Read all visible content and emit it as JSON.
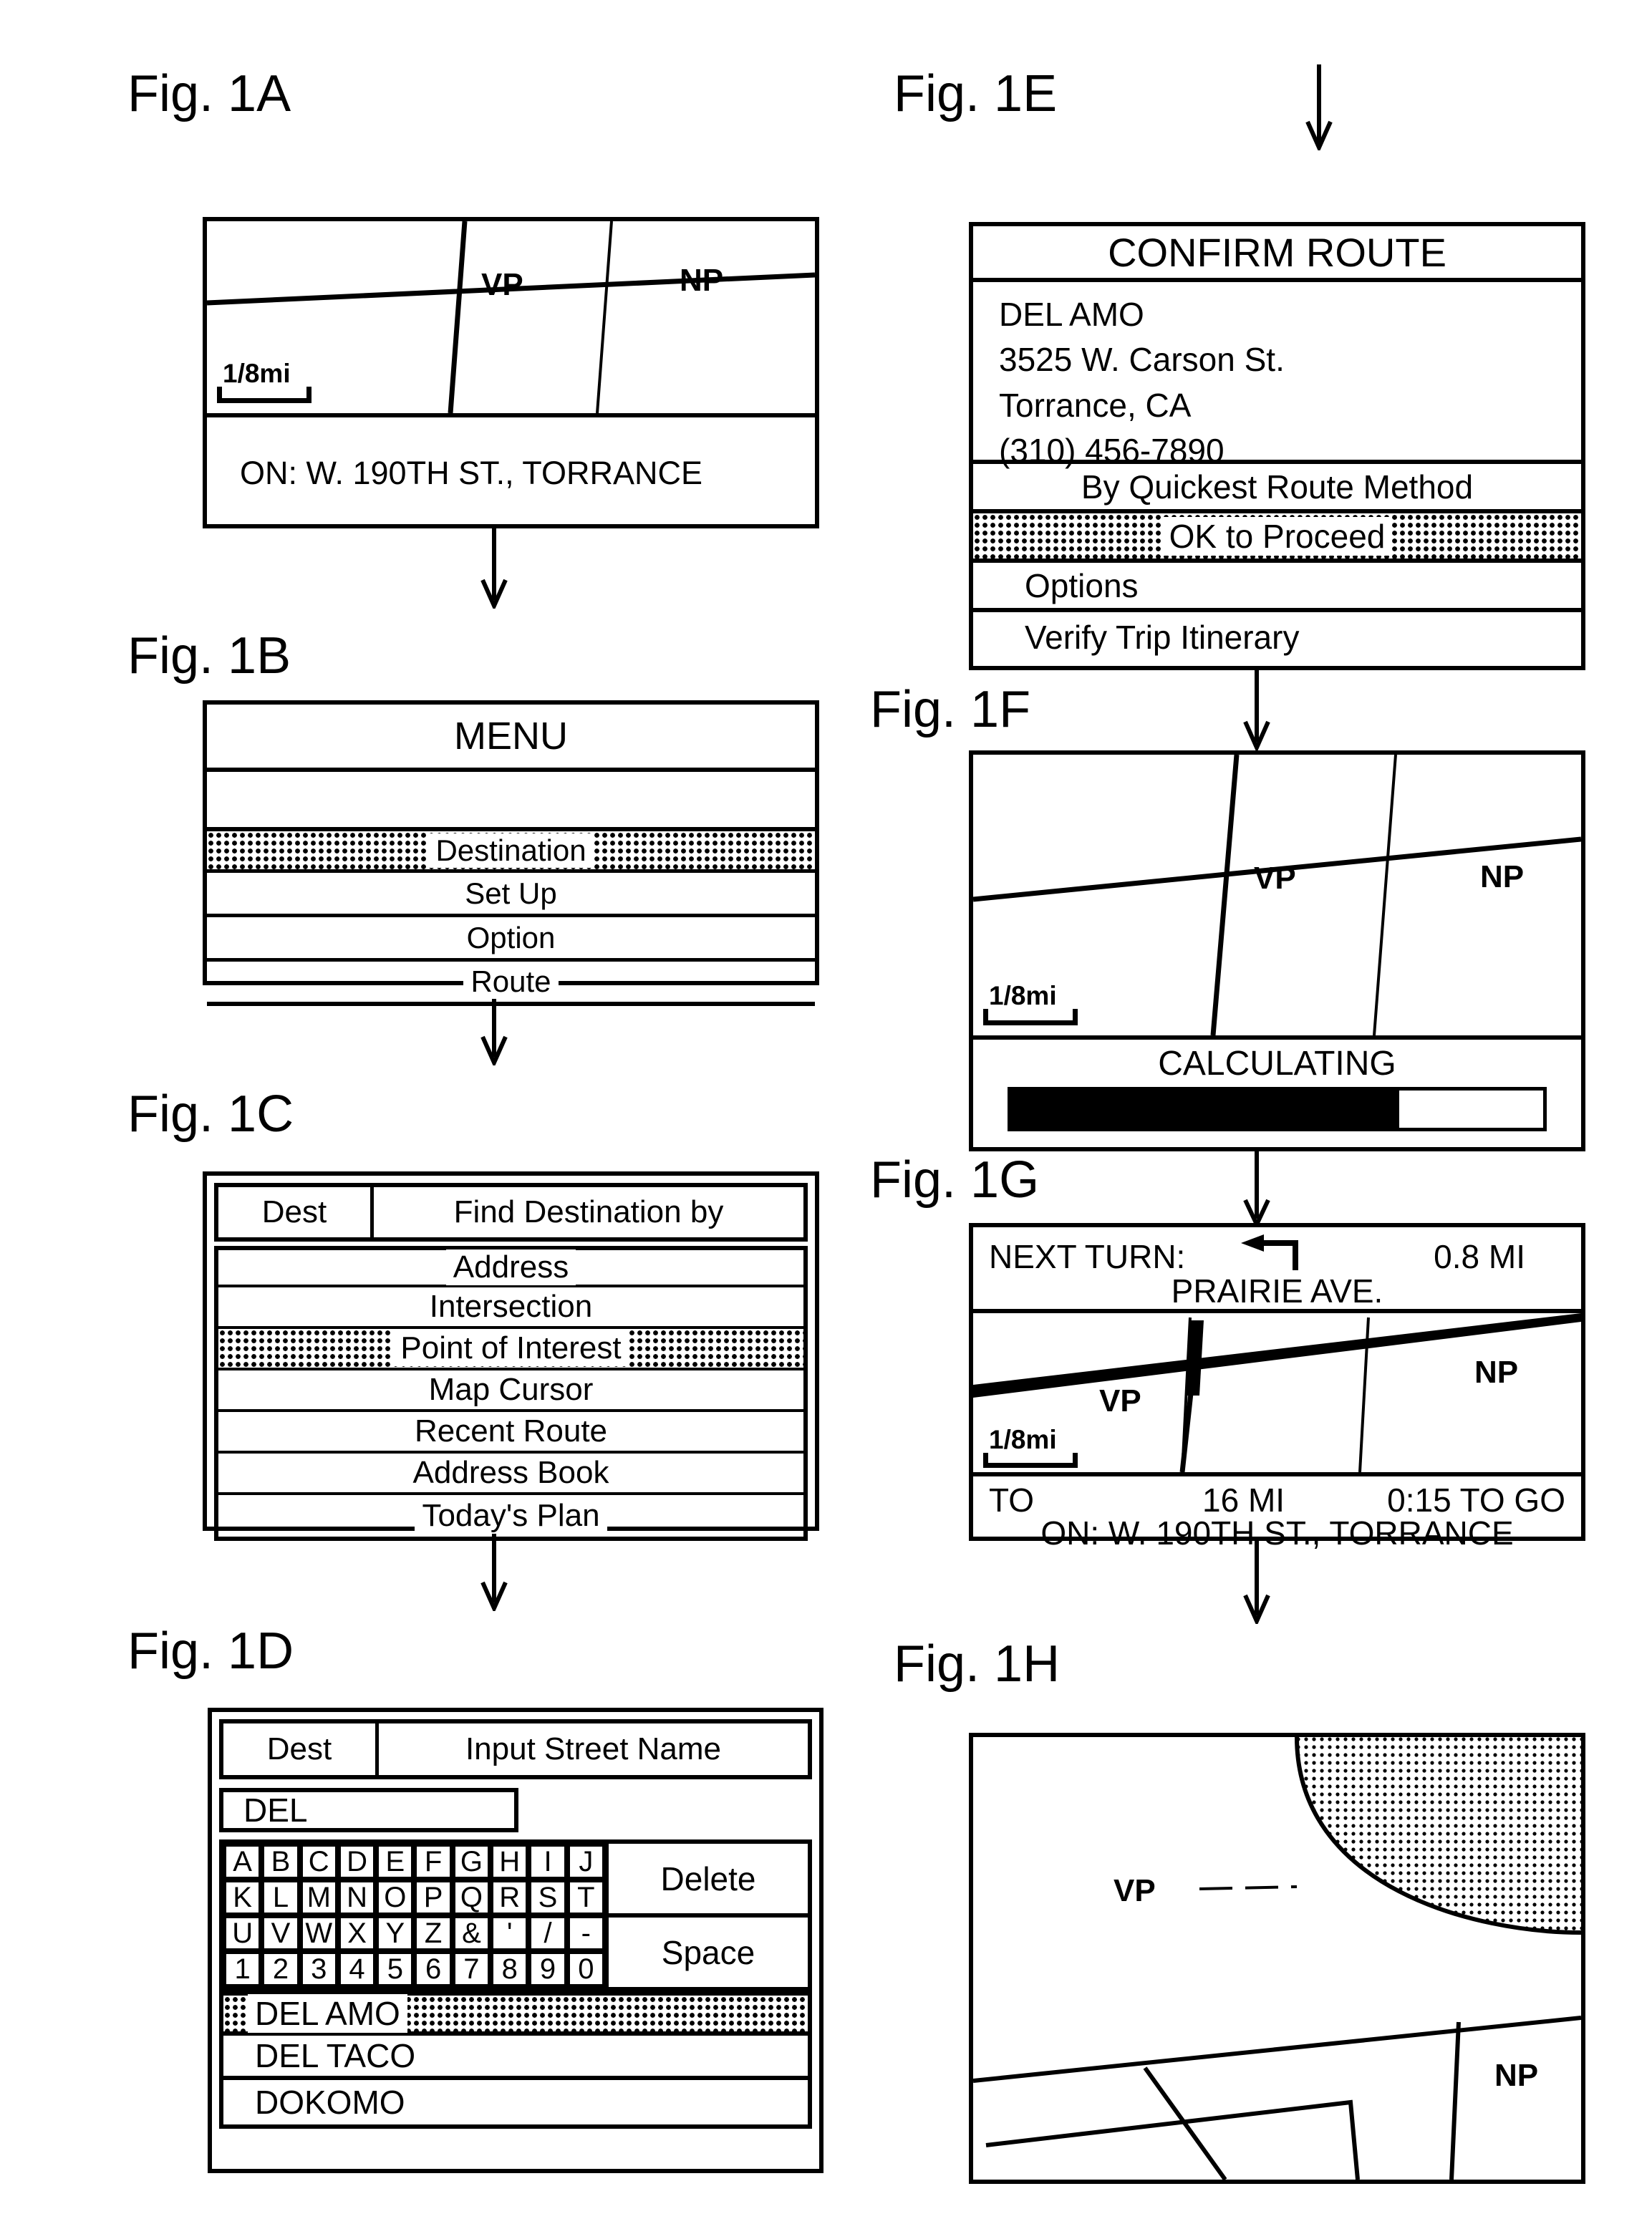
{
  "figure": {
    "labels": {
      "a": "Fig. 1A",
      "b": "Fig. 1B",
      "c": "Fig. 1C",
      "d": "Fig. 1D",
      "e": "Fig. 1E",
      "f": "Fig. 1F",
      "g": "Fig. 1G",
      "h": "Fig. 1H"
    }
  },
  "fig1a": {
    "map": {
      "scale_label": "1/8mi",
      "vehicle_marker": "VP",
      "north_marker": "NP"
    },
    "status_bar": "ON:  W. 190TH ST., TORRANCE"
  },
  "fig1b": {
    "title": "MENU",
    "items": [
      {
        "label": "Destination",
        "highlighted": true
      },
      {
        "label": "Set Up",
        "highlighted": false
      },
      {
        "label": "Option",
        "highlighted": false
      },
      {
        "label": "Route",
        "highlighted": false
      }
    ]
  },
  "fig1c": {
    "header_left": "Dest",
    "header_right": "Find Destination by",
    "items": [
      {
        "label": "Address",
        "highlighted": false
      },
      {
        "label": "Intersection",
        "highlighted": false
      },
      {
        "label": "Point of Interest",
        "highlighted": true
      },
      {
        "label": "Map Cursor",
        "highlighted": false
      },
      {
        "label": "Recent Route",
        "highlighted": false
      },
      {
        "label": "Address Book",
        "highlighted": false
      },
      {
        "label": "Today's Plan",
        "highlighted": false
      }
    ]
  },
  "fig1d": {
    "header_left": "Dest",
    "header_right": "Input Street Name",
    "input_value": "DEL",
    "keyboard_rows": [
      [
        "A",
        "B",
        "C",
        "D",
        "E",
        "F",
        "G",
        "H",
        "I",
        "J"
      ],
      [
        "K",
        "L",
        "M",
        "N",
        "O",
        "P",
        "Q",
        "R",
        "S",
        "T"
      ],
      [
        "U",
        "V",
        "W",
        "X",
        "Y",
        "Z",
        "&",
        "'",
        "/",
        "-"
      ],
      [
        "1",
        "2",
        "3",
        "4",
        "5",
        "6",
        "7",
        "8",
        "9",
        "0"
      ]
    ],
    "delete_label": "Delete",
    "space_label": "Space",
    "results": [
      {
        "label": "DEL AMO",
        "highlighted": true
      },
      {
        "label": "DEL TACO",
        "highlighted": false
      },
      {
        "label": "DOKOMO",
        "highlighted": false
      }
    ]
  },
  "fig1e": {
    "title": "CONFIRM ROUTE",
    "address_lines": [
      "DEL AMO",
      "3525 W. Carson St.",
      "Torrance, CA",
      "(310) 456-7890"
    ],
    "items": [
      {
        "label": "By Quickest Route Method",
        "highlighted": false
      },
      {
        "label": "OK to Proceed",
        "highlighted": true
      },
      {
        "label": "Options",
        "highlighted": false
      },
      {
        "label": "Verify Trip Itinerary",
        "highlighted": false
      }
    ]
  },
  "fig1f": {
    "map": {
      "scale_label": "1/8mi",
      "vehicle_marker": "VP",
      "north_marker": "NP"
    },
    "status_text": "CALCULATING",
    "progress_percent": 73
  },
  "fig1g": {
    "next_turn_label": "NEXT TURN:",
    "next_turn_icon": "left-turn-arrow-icon",
    "next_turn_distance": "0.8 MI",
    "next_turn_street": "PRAIRIE AVE.",
    "map": {
      "scale_label": "1/8mi",
      "vehicle_marker": "VP",
      "north_marker": "NP"
    },
    "trip_to_label": "TO",
    "trip_distance": "16 MI",
    "trip_time": "0:15 TO GO",
    "status_bar": "ON:  W. 190TH ST., TORRANCE"
  },
  "fig1h": {
    "map": {
      "vehicle_marker": "VP",
      "north_marker": "NP"
    }
  }
}
